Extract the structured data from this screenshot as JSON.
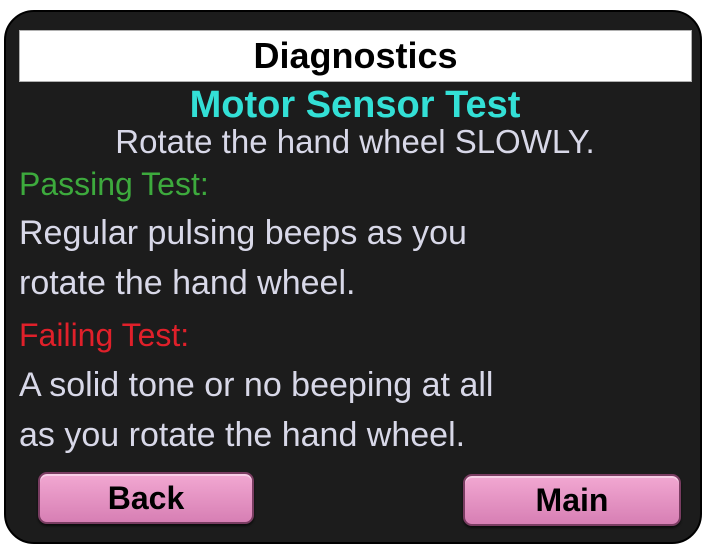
{
  "header": {
    "title": "Diagnostics"
  },
  "test": {
    "name": "Motor Sensor Test",
    "instruction": "Rotate the hand wheel SLOWLY.",
    "passing_label": "Passing Test:",
    "passing_line1": "Regular pulsing beeps as you",
    "passing_line2": "rotate the hand wheel.",
    "failing_label": "Failing Test:",
    "failing_line1": "A solid tone or no beeping at all",
    "failing_line2": "as you rotate the hand wheel."
  },
  "buttons": {
    "back_label": "Back",
    "main_label": "Main"
  },
  "colors": {
    "background": "#1c1c1c",
    "title_bar": "#ffffff",
    "subtitle": "#33e0d6",
    "body_text": "#d8d8e8",
    "passing": "#3daa3d",
    "failing": "#e0202a",
    "button": "#e392c2"
  }
}
